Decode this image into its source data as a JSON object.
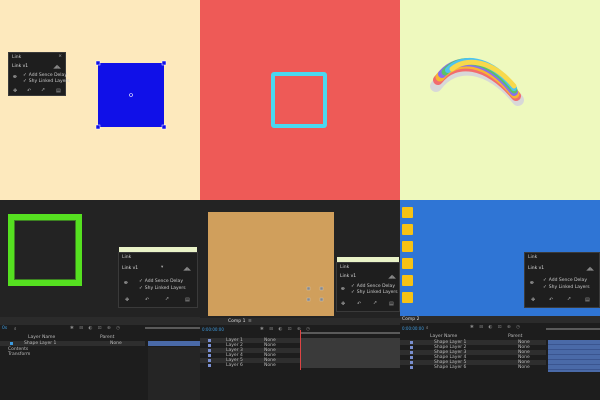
{
  "panel": {
    "title": "Link",
    "close": "×",
    "select_value": "Link v1",
    "shapes": "◢◣",
    "option_add": "Add Sence Delay",
    "option_shy": "Shy Linked Layers",
    "check": "✓",
    "link_icon": "link-icon"
  },
  "tile4": {
    "panel_title": "Link",
    "select_value": "Link v1",
    "option_add": "Add Sence Delay",
    "option_shy": "Shy Linked Layers",
    "timeline": {
      "col_layer": "Layer Name",
      "col_parent": "Parent",
      "layer_name": "Shape Layer 1",
      "mode": "None",
      "contents": "Contents",
      "transform": "Transform"
    }
  },
  "tile5": {
    "tab": "Comp 1",
    "tab_close": "≡",
    "timecode": "0:00:00:00",
    "mode": "None",
    "layers": [
      "Layer 1",
      "Layer 2",
      "Layer 3",
      "Layer 4",
      "Layer 5",
      "Layer 6"
    ]
  },
  "tile6": {
    "tab": "Comp 2",
    "timecode": "0:00:00:00",
    "col_layer": "Layer Name",
    "col_parent": "Parent",
    "layers": [
      "Shape Layer 1",
      "Shape Layer 2",
      "Shape Layer 3",
      "Shape Layer 4",
      "Shape Layer 5",
      "Shape Layer 6"
    ],
    "mode": "None"
  },
  "colors": {
    "t1_bg": "#fde9bd",
    "t2_bg": "#ee5a57",
    "t3_bg": "#eef9be",
    "t6_bg": "#2f75d5",
    "blue_square": "#1010e8",
    "cyan_square": "#4ad8f0",
    "green_square": "#55e020",
    "tan_rect": "#d09f5c",
    "yellow_square": "#f6c214",
    "accent_blue": "#3d9be0"
  }
}
